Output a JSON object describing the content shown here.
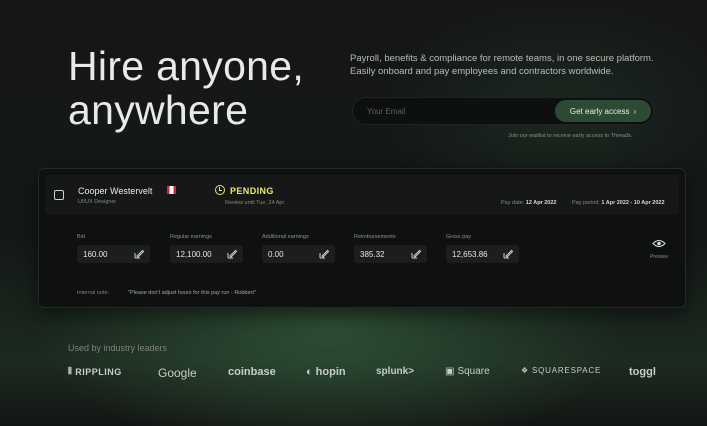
{
  "hero": {
    "title_line1": "Hire anyone,",
    "title_line2": "anywhere",
    "tagline": "Payroll, benefits & compliance for remote teams, in one secure platform. Easily onboard and pay employees and contractors worldwide."
  },
  "form": {
    "email_placeholder": "Your Email",
    "cta_label": "Get early access",
    "cta_arrow": "›",
    "waitlist_note": "Join our waitlist to receive early access to Threads."
  },
  "payrun": {
    "employee_name": "Cooper Westervelt",
    "employee_role": "UI/UX Designer",
    "status": "PENDING",
    "review_note": "Review until Tue, 24 Apr",
    "pay_date_label": "Pay date:",
    "pay_date": "12 Apr 2022",
    "pay_period_label": "Pay period:",
    "pay_period": "1 Apr 2022 - 10 Apr 2022",
    "fields": [
      {
        "label": "Bid",
        "value": "160.00"
      },
      {
        "label": "Regular earnings",
        "value": "12,100.00"
      },
      {
        "label": "Additional earnings",
        "value": "0.00"
      },
      {
        "label": "Reimbursements",
        "value": "385.32"
      },
      {
        "label": "Gross pay",
        "value": "12,653.86"
      }
    ],
    "preview_label": "Preview",
    "internal_note_label": "Internal note:",
    "internal_note": "\"Please don't adjust hours for this pay run - Robbert\""
  },
  "partners": {
    "heading": "Used by industry leaders",
    "logos": [
      "RIPPLING",
      "Google",
      "coinbase",
      "hopin",
      "splunk>",
      "Square",
      "SQUARESPACE",
      "toggl"
    ]
  },
  "colors": {
    "accent_green": "#2c4a34",
    "pending_yellow": "#ece86e"
  }
}
